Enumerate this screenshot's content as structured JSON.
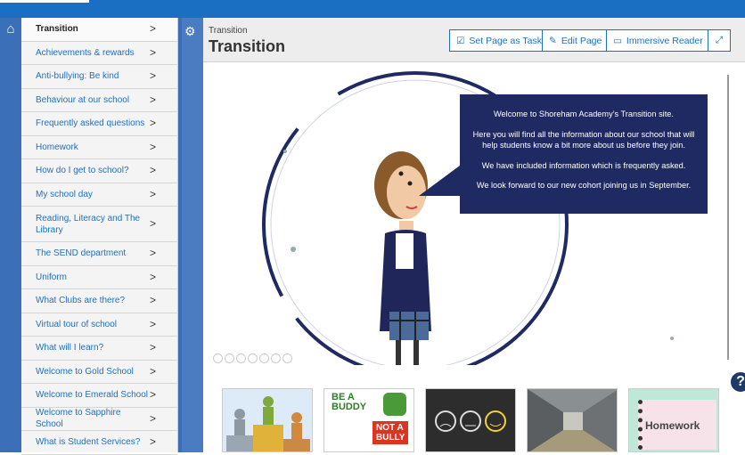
{
  "nav": {
    "items": [
      {
        "label": "Transition",
        "active": true
      },
      {
        "label": "Achievements & rewards"
      },
      {
        "label": "Anti-bullying: Be kind"
      },
      {
        "label": "Behaviour at our school"
      },
      {
        "label": "Frequently asked questions"
      },
      {
        "label": "Homework"
      },
      {
        "label": "How do I get to school?"
      },
      {
        "label": "My school day"
      },
      {
        "label": "Reading, Literacy and The Library"
      },
      {
        "label": "The SEND department"
      },
      {
        "label": "Uniform"
      },
      {
        "label": "What Clubs are there?"
      },
      {
        "label": "Virtual tour of school"
      },
      {
        "label": "What will I learn?"
      },
      {
        "label": "Welcome to Gold School"
      },
      {
        "label": "Welcome to Emerald School"
      },
      {
        "label": "Welcome to Sapphire School"
      },
      {
        "label": "What is Student Services?"
      }
    ],
    "chevron": ">"
  },
  "header": {
    "breadcrumb": "Transition",
    "title": "Transition",
    "buttons": {
      "set_task": "Set Page as Task",
      "edit": "Edit Page",
      "immersive": "Immersive Reader"
    }
  },
  "hero": {
    "bubble": [
      "Welcome to Shoreham Academy’s Transition site.",
      "Here you will find all the information about our school that will help students know a bit more about us before they join.",
      "We have included information which is frequently asked.",
      "We look forward to our new cohort joining us in September."
    ]
  },
  "thumbs": {
    "buddy_top": "BE A",
    "buddy_mid": "BUDDY",
    "buddy_not": "NOT A",
    "buddy_bully": "BULLY",
    "homework": "Homework"
  },
  "help": "?",
  "colors": {
    "accent": "#1d70c1",
    "topbar": "#1b6fc2",
    "bubble": "#1f2a63"
  }
}
